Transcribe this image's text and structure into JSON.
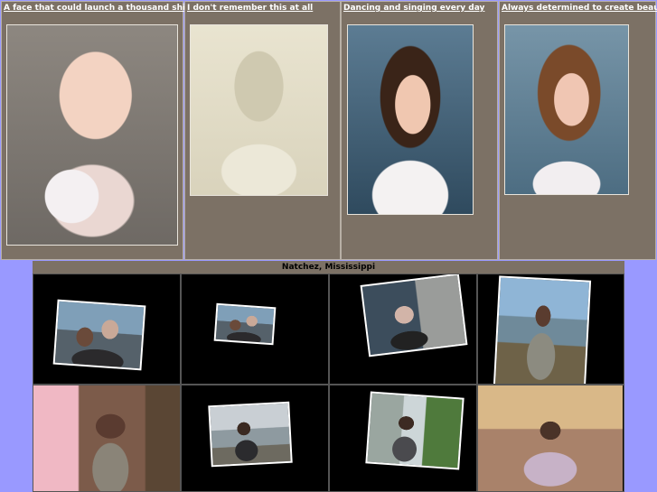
{
  "portraits": [
    {
      "caption": "A face that could launch a thousand ships",
      "photo": "toddler-portrait"
    },
    {
      "caption": "I don't remember this at all",
      "photo": "boy-vintage-portrait"
    },
    {
      "caption": "Dancing and singing every day",
      "photo": "girl-portrait"
    },
    {
      "caption": "Always determined to create beauty",
      "photo": "girl-portrait"
    }
  ],
  "gallery": {
    "title": "Natchez, Mississippi",
    "tiles": [
      {
        "photo": "couple-snapshot"
      },
      {
        "photo": "couple-snapshot"
      },
      {
        "photo": "man-on-porch-snapshot"
      },
      {
        "photo": "woman-by-water-snapshot"
      },
      {
        "photo": "woman-in-room-photo"
      },
      {
        "photo": "woman-at-beach-snapshot"
      },
      {
        "photo": "woman-in-yard-snapshot"
      },
      {
        "photo": "woman-on-sofa-photo"
      }
    ]
  },
  "colors": {
    "page_background": "#9999ff",
    "cell_background": "#7c7165",
    "gallery_background": "#000000"
  }
}
